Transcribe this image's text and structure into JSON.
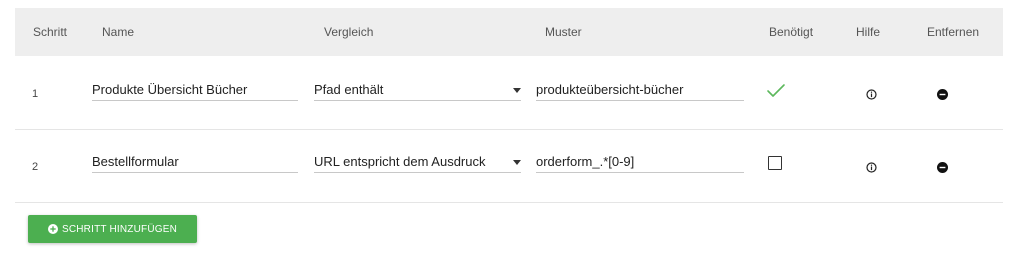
{
  "table": {
    "headers": {
      "step": "Schritt",
      "name": "Name",
      "comparison": "Vergleich",
      "pattern": "Muster",
      "required": "Benötigt",
      "help": "Hilfe",
      "remove": "Entfernen"
    },
    "rows": [
      {
        "step": "1",
        "name": "Produkte Übersicht Bücher",
        "comparison": "Pfad enthält",
        "pattern": "produkteübersicht-bücher",
        "required": true
      },
      {
        "step": "2",
        "name": "Bestellformular",
        "comparison": "URL entspricht dem Ausdruck",
        "pattern": "orderform_.*[0-9]",
        "required": false
      }
    ]
  },
  "actions": {
    "add_step_label": "SCHRITT HINZUFÜGEN"
  },
  "colors": {
    "accent_green": "#4caf50",
    "check_green": "#5cb85c",
    "header_bg": "#eeeeee"
  },
  "icons": {
    "required_true": "checkmark-icon",
    "required_false": "checkbox-icon",
    "help": "info-icon",
    "remove": "minus-circle-icon",
    "add": "plus-circle-icon",
    "select": "caret-down-icon"
  }
}
